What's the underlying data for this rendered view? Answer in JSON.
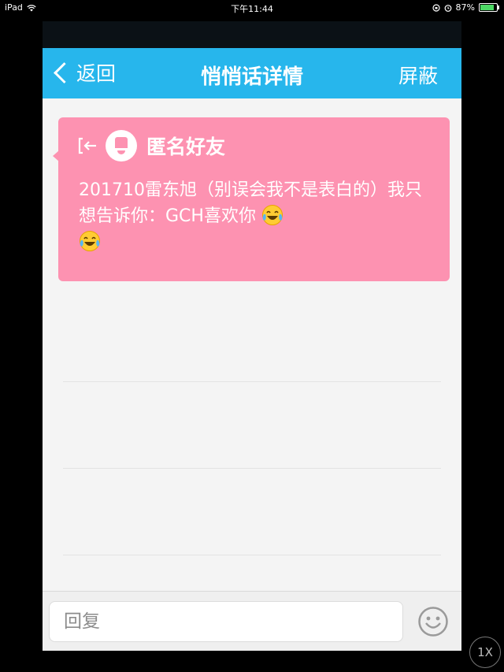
{
  "status_bar": {
    "device": "iPad",
    "time": "下午11:44",
    "battery": "87%",
    "battery_level": 0.87
  },
  "navbar": {
    "back_label": "返回",
    "title": "悄悄话详情",
    "block_label": "屏蔽"
  },
  "message": {
    "sender": "匿名好友",
    "text": "201710雷东旭（别误会我不是表白的）我只想告诉你：GCH喜欢你",
    "emoji_icons": [
      "tears-of-joy-emoji-icon",
      "tears-of-joy-emoji-icon"
    ]
  },
  "input": {
    "placeholder": "回复"
  },
  "zoom_label": "1X",
  "colors": {
    "navbar": "#27b6ec",
    "card": "#fd92b1",
    "background": "#f4f4f4"
  }
}
